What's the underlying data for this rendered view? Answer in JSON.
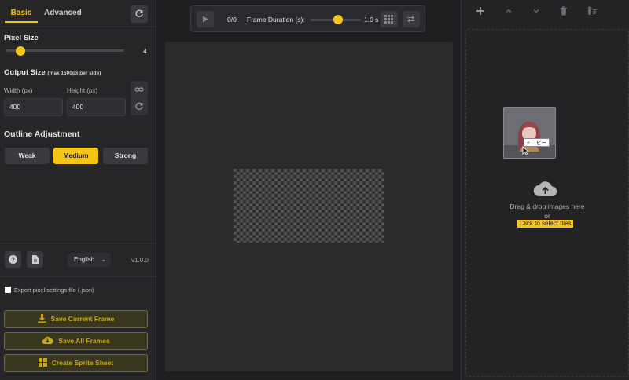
{
  "tabs": {
    "basic": "Basic",
    "advanced": "Advanced"
  },
  "pixel_size": {
    "title": "Pixel Size",
    "value": "4",
    "slider_fraction": 0.12
  },
  "output_size": {
    "title": "Output Size",
    "note": "(max 1500px per side)",
    "width_label": "Width (px)",
    "width_value": "400",
    "height_label": "Height (px)",
    "height_value": "400"
  },
  "outline": {
    "title": "Outline Adjustment",
    "options": [
      "Weak",
      "Medium",
      "Strong"
    ],
    "selected": "Medium"
  },
  "footer": {
    "language": "English",
    "version": "v1.0.0"
  },
  "export_json": {
    "label": "Export pixel settings file (.json)",
    "checked": false
  },
  "actions": {
    "save_current": "Save Current Frame",
    "save_all": "Save All Frames",
    "sprite_sheet": "Create Sprite Sheet"
  },
  "player": {
    "frame_counter": "0/0",
    "duration_label": "Frame Duration (s):",
    "duration_value": "1.0 s",
    "duration_fraction": 0.55
  },
  "dropzone": {
    "line1": "Drag & drop images here",
    "line2": "or",
    "link": "Click to select files",
    "copy_tooltip": "+ コピー"
  },
  "colors": {
    "accent": "#f5c518",
    "panel": "#262629",
    "background": "#1f1f22"
  },
  "icons": [
    "refresh-icon",
    "link-icon",
    "help-icon",
    "document-icon",
    "download-icon",
    "cloud-upload-icon",
    "grid-icon",
    "play-icon",
    "swap-icon",
    "plus-icon",
    "arrow-up-icon",
    "arrow-down-icon",
    "trash-icon",
    "clear-list-icon"
  ]
}
